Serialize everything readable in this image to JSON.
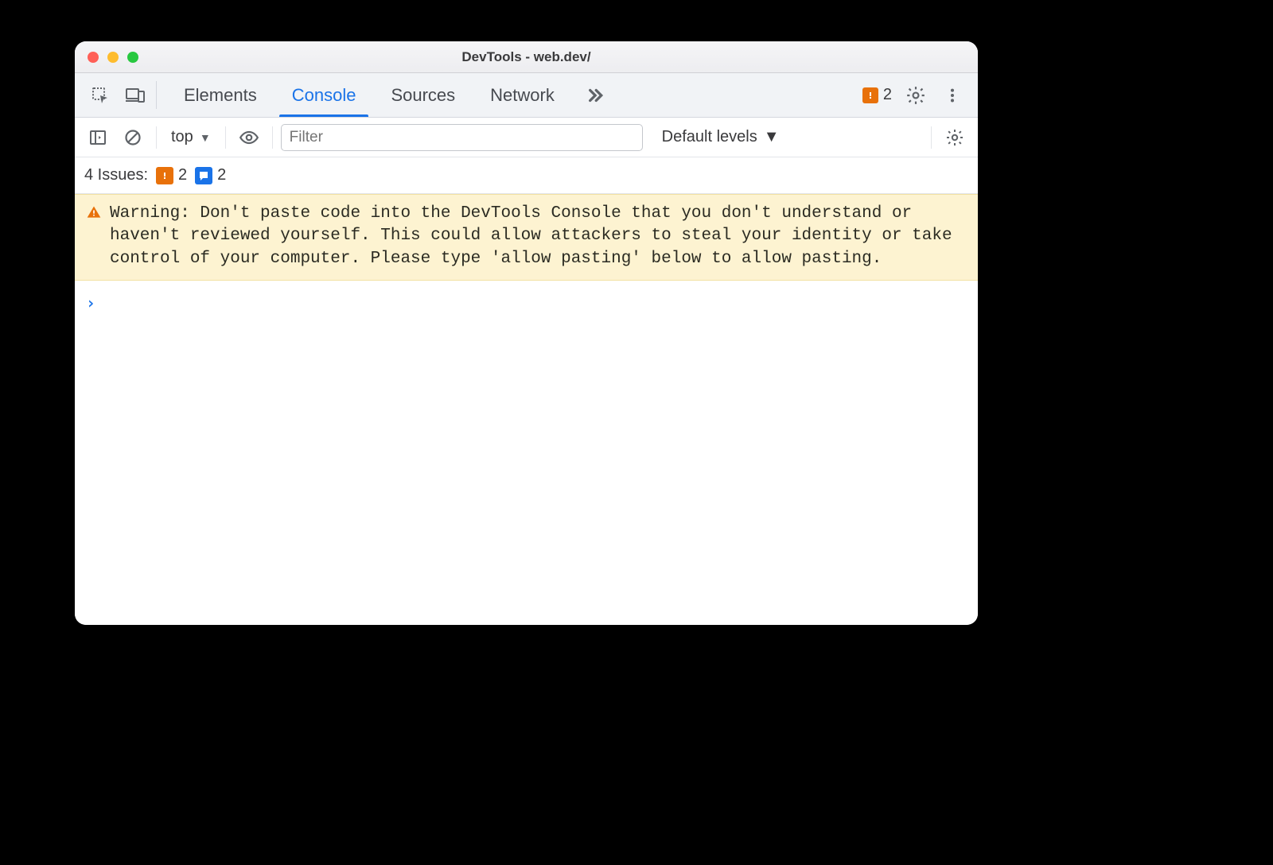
{
  "window": {
    "title": "DevTools - web.dev/"
  },
  "tabs": {
    "items": [
      "Elements",
      "Console",
      "Sources",
      "Network"
    ],
    "active_index": 1
  },
  "tabbar_right": {
    "error_count": "2"
  },
  "toolbar": {
    "context_label": "top",
    "filter_placeholder": "Filter",
    "levels_label": "Default levels"
  },
  "issues": {
    "label": "4 Issues:",
    "orange_count": "2",
    "blue_count": "2"
  },
  "warning": {
    "text": "Warning: Don't paste code into the DevTools Console that you don't understand or haven't reviewed yourself. This could allow attackers to steal your identity or take control of your computer. Please type 'allow pasting' below to allow pasting."
  },
  "prompt": {
    "symbol": "›"
  }
}
